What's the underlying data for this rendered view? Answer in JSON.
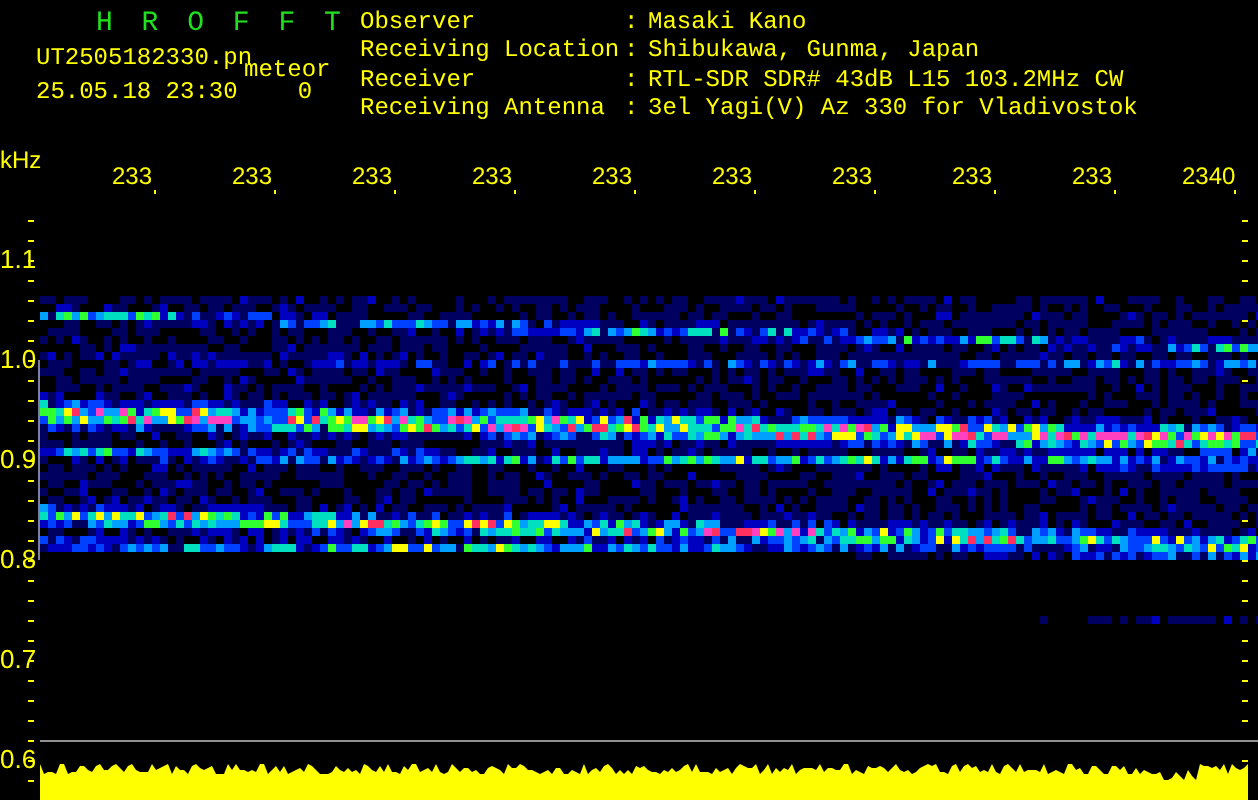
{
  "header": {
    "title": "H R O F F T",
    "filename": "UT2505182330.pn",
    "mode": "meteor",
    "datetime": "25.05.18 23:30",
    "counter": "0"
  },
  "station_info": [
    {
      "label": "Observer",
      "separator": ":",
      "value": "Masaki Kano"
    },
    {
      "label": "Receiving Location",
      "separator": ":",
      "value": "Shibukawa, Gunma, Japan"
    },
    {
      "label": "Receiver",
      "separator": ":",
      "value": "RTL-SDR SDR# 43dB L15 103.2MHz CW"
    },
    {
      "label": "Receiving Antenna",
      "separator": ":",
      "value": "3el Yagi(V) Az 330 for Vladivostok"
    }
  ],
  "chart": {
    "unit_label": "kHz",
    "time_labels": [
      "233",
      "233",
      "233",
      "233",
      "233",
      "233",
      "233",
      "233",
      "233",
      "2340"
    ],
    "frequency_labels": [
      "1.1",
      "1.0",
      "0.9",
      "0.8",
      "0.7",
      "0.6"
    ]
  }
}
